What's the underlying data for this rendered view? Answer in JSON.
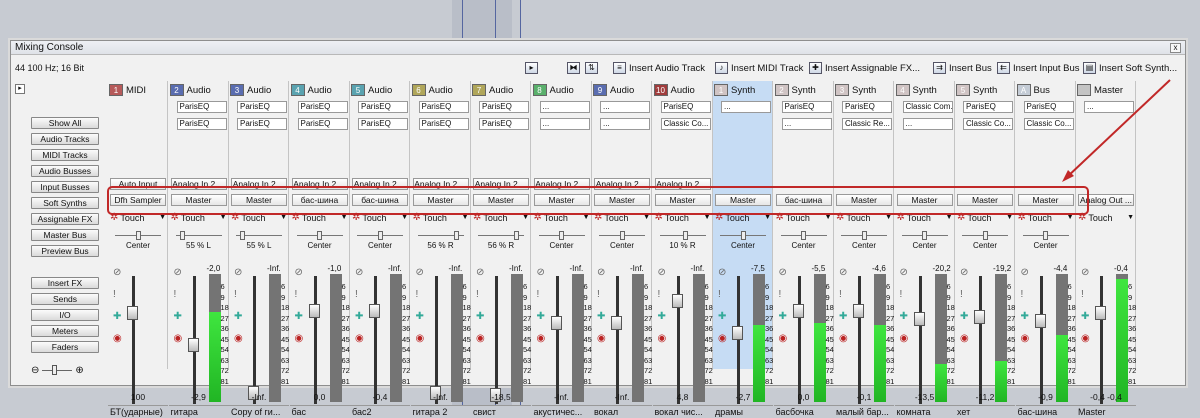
{
  "window": {
    "title": "Mixing Console",
    "close_glyph": "x"
  },
  "toolbar": {
    "sample_rate": "44 100 Hz; 16 Bit",
    "buttons": [
      {
        "label": "Insert Audio Track",
        "icon": "insert-audio-track-icon"
      },
      {
        "label": "Insert MIDI Track",
        "icon": "insert-midi-track-icon"
      },
      {
        "label": "Insert Assignable FX...",
        "icon": "insert-assignable-fx-icon"
      },
      {
        "label": "Insert Bus",
        "icon": "insert-bus-icon"
      },
      {
        "label": "Insert Input Bus",
        "icon": "insert-input-bus-icon"
      },
      {
        "label": "Insert Soft Synth...",
        "icon": "insert-soft-synth-icon"
      }
    ]
  },
  "left_panel": {
    "view_buttons": [
      "Show All",
      "Audio Tracks",
      "MIDI Tracks",
      "Audio Busses",
      "Input Busses",
      "Soft Synths",
      "Assignable FX",
      "Master Bus",
      "Preview Bus"
    ],
    "section_buttons": [
      "Insert FX",
      "Sends",
      "I/O",
      "Meters",
      "Faders"
    ]
  },
  "automation_label": "Touch",
  "strips": [
    {
      "num": "1",
      "type": "MIDI",
      "color": "#b65a5a",
      "fx": [],
      "input": "Auto Input",
      "output": "Dfh Sampler",
      "pan": "Center",
      "value": "100",
      "name": "БТ(ударные)"
    },
    {
      "num": "2",
      "type": "Audio",
      "color": "#5a6db0",
      "fx": [
        "ParisEQ",
        "ParisEQ"
      ],
      "input": "Analog In 2 ...",
      "output": "Master",
      "pan": "55 % L",
      "peak": "-2,0",
      "value": "-2,9",
      "name": "гитара"
    },
    {
      "num": "3",
      "type": "Audio",
      "color": "#5a6db0",
      "fx": [
        "ParisEQ",
        "ParisEQ"
      ],
      "input": "Analog In 2 ...",
      "output": "Master",
      "pan": "55 % L",
      "peak": "-Inf.",
      "value": "-Inf.",
      "name": "Copy of ги..."
    },
    {
      "num": "4",
      "type": "Audio",
      "color": "#5aa3b0",
      "fx": [
        "ParisEQ",
        "ParisEQ"
      ],
      "input": "Analog In 2 ...",
      "output": "бас-шина",
      "pan": "Center",
      "peak": "-1,0",
      "value": "0,0",
      "name": "бас"
    },
    {
      "num": "5",
      "type": "Audio",
      "color": "#5aa3b0",
      "fx": [
        "ParisEQ",
        "ParisEQ"
      ],
      "input": "Analog In 2 ...",
      "output": "бас-шина",
      "pan": "Center",
      "peak": "-Inf.",
      "value": "-0,4",
      "name": "бас2"
    },
    {
      "num": "6",
      "type": "Audio",
      "color": "#b0a65a",
      "fx": [
        "ParisEQ",
        "ParisEQ"
      ],
      "input": "Analog In 2 ...",
      "output": "Master",
      "pan": "56 % R",
      "peak": "-Inf.",
      "value": "-Inf.",
      "name": "гитара 2"
    },
    {
      "num": "7",
      "type": "Audio",
      "color": "#b0a65a",
      "fx": [
        "ParisEQ",
        "ParisEQ"
      ],
      "input": "Analog In 2 ...",
      "output": "Master",
      "pan": "56 % R",
      "peak": "-Inf.",
      "value": "-18,5",
      "name": "свист"
    },
    {
      "num": "8",
      "type": "Audio",
      "color": "#5ab06c",
      "fx": [
        "...",
        "..."
      ],
      "input": "Analog In 2 ...",
      "output": "Master",
      "pan": "Center",
      "peak": "-Inf.",
      "value": "-Inf.",
      "name": "акустичес..."
    },
    {
      "num": "9",
      "type": "Audio",
      "color": "#5a6db0",
      "fx": [
        "...",
        "..."
      ],
      "input": "Analog In 2 ...",
      "output": "Master",
      "pan": "Center",
      "peak": "-Inf.",
      "value": "-Inf.",
      "name": "вокал"
    },
    {
      "num": "10",
      "type": "Audio",
      "color": "#a03c3c",
      "fx": [
        "ParisEQ",
        "Classic Co..."
      ],
      "input": "Analog In 2 ...",
      "output": "Master",
      "pan": "10 % R",
      "peak": "-Inf.",
      "value": "4,8",
      "name": "вокал чис..."
    },
    {
      "num": "1",
      "type": "Synth",
      "color": "#d0c4c4",
      "fx": [
        "..."
      ],
      "input": "",
      "output": "Master",
      "pan": "Center",
      "peak": "-7,5",
      "value": "-2,7",
      "name": "драмы",
      "selected": true
    },
    {
      "num": "2",
      "type": "Synth",
      "color": "#d0c4c4",
      "fx": [
        "ParisEQ",
        "..."
      ],
      "input": "",
      "output": "бас-шина",
      "pan": "Center",
      "peak": "-5,5",
      "value": "0,0",
      "name": "басбочка"
    },
    {
      "num": "3",
      "type": "Synth",
      "color": "#d0c4c4",
      "fx": [
        "ParisEQ",
        "Classic Re..."
      ],
      "input": "",
      "output": "Master",
      "pan": "Center",
      "peak": "-4,6",
      "value": "-0,1",
      "name": "малый бар..."
    },
    {
      "num": "4",
      "type": "Synth",
      "color": "#d0c4c4",
      "fx": [
        "Classic Com...",
        "..."
      ],
      "input": "",
      "output": "Master",
      "pan": "Center",
      "peak": "-20,2",
      "value": "-13,5",
      "name": "комната"
    },
    {
      "num": "5",
      "type": "Synth",
      "color": "#d0c4c4",
      "fx": [
        "ParisEQ",
        "Classic Co..."
      ],
      "input": "",
      "output": "Master",
      "pan": "Center",
      "peak": "-19,2",
      "value": "-11,2",
      "name": "хет"
    },
    {
      "num": "A",
      "type": "Bus",
      "color": "#c4ccd6",
      "fx": [
        "ParisEQ",
        "Classic Co..."
      ],
      "input": "",
      "output": "Master",
      "pan": "Center",
      "peak": "-4,4",
      "value": "-0,9",
      "name": "бас-шина"
    },
    {
      "num": "",
      "type": "Master",
      "color": "#c4c4c4",
      "fx": [
        "..."
      ],
      "input": "",
      "output": "Analog Out ...",
      "pan": "",
      "peak": "-0,4",
      "value": "-0,4  -0,4",
      "name": "Master"
    }
  ],
  "meter_scale": [
    "6",
    "9",
    "18",
    "27",
    "36",
    "45",
    "54",
    "63",
    "72",
    "81"
  ]
}
